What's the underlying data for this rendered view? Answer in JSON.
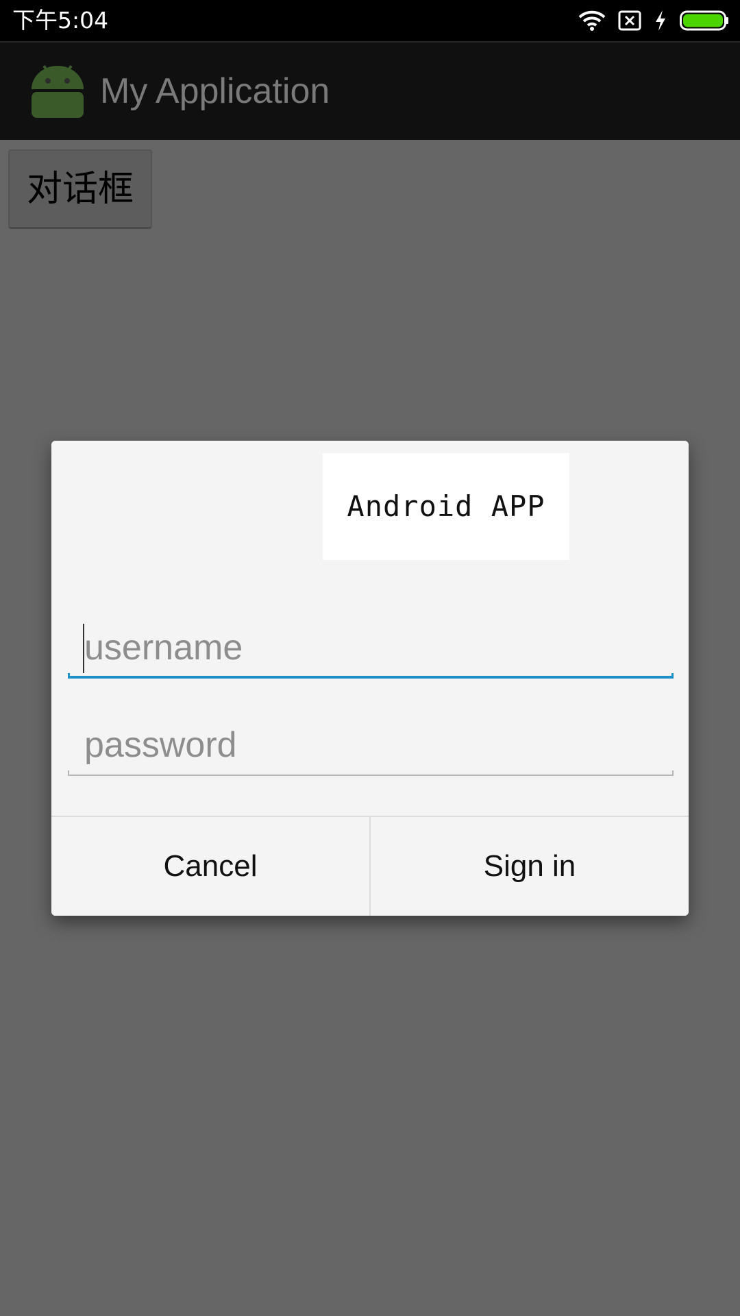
{
  "status_bar": {
    "time": "下午5:04",
    "icons": [
      "wifi-icon",
      "no-sim-icon",
      "charging-icon",
      "battery-icon"
    ],
    "battery_color": "#4cd400"
  },
  "action_bar": {
    "title": "My Application",
    "icon": "android-icon",
    "icon_color": "#3b5a2a"
  },
  "content": {
    "dialog_button_label": "对话框"
  },
  "dialog": {
    "logo_text": "Android APP",
    "username": {
      "value": "",
      "placeholder": "username",
      "focused": true
    },
    "password": {
      "value": "",
      "placeholder": "password"
    },
    "buttons": {
      "cancel": "Cancel",
      "sign_in": "Sign in"
    },
    "accent_color": "#1e90c8"
  }
}
